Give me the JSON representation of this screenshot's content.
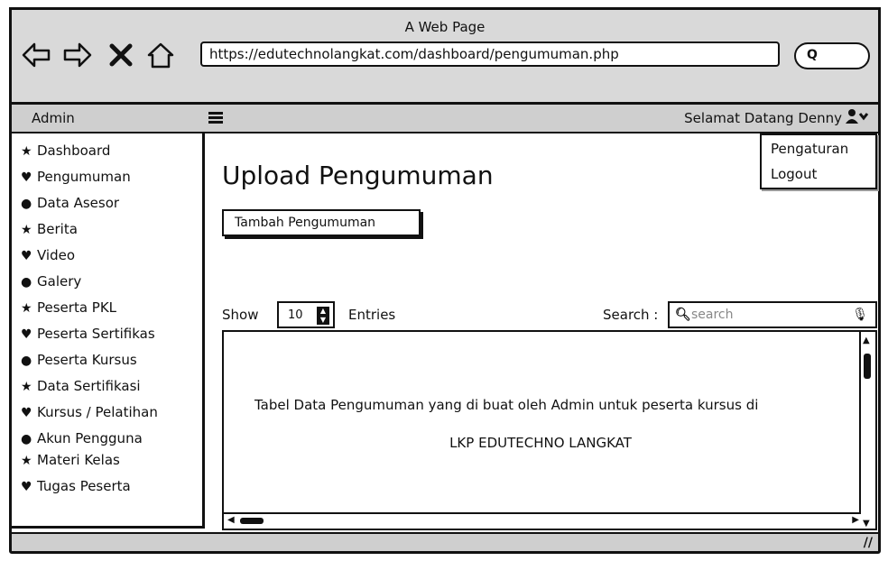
{
  "window": {
    "title": "A Web Page"
  },
  "browser": {
    "url": "https://edutechnolangkat.com/dashboard/pengumuman.php",
    "nav_icons": [
      "back-arrow-icon",
      "forward-arrow-icon",
      "close-x-icon",
      "home-icon"
    ],
    "search_icon": "Q"
  },
  "menubar": {
    "brand": "Admin",
    "greeting": "Selamat Datang Denny",
    "user_icon": "user-icon"
  },
  "user_menu": {
    "items": [
      "Pengaturan",
      "Logout"
    ]
  },
  "sidebar": {
    "items": [
      {
        "label": "Dashboard",
        "icon": "star"
      },
      {
        "label": "Pengumuman",
        "icon": "heart"
      },
      {
        "label": "Data Asesor",
        "icon": "circle"
      },
      {
        "label": "Berita",
        "icon": "star"
      },
      {
        "label": "Video",
        "icon": "heart"
      },
      {
        "label": "Galery",
        "icon": "circle"
      },
      {
        "label": "Peserta PKL",
        "icon": "star"
      },
      {
        "label": "Peserta Sertifikas",
        "icon": "heart"
      },
      {
        "label": "Peserta Kursus",
        "icon": "circle"
      },
      {
        "label": "Data Sertifikasi",
        "icon": "star"
      },
      {
        "label": "Kursus / Pelatihan",
        "icon": "heart"
      },
      {
        "label": "Akun Pengguna",
        "icon": "circle"
      },
      {
        "label": "Materi Kelas",
        "icon": "star"
      },
      {
        "label": "Tugas Peserta",
        "icon": "heart"
      }
    ]
  },
  "main": {
    "title": "Upload Pengumuman",
    "add_button": "Tambah Pengumuman",
    "show_label": "Show",
    "entries_value": "10",
    "entries_label": "Entries",
    "search_label": "Search :",
    "search_placeholder": "search",
    "table_text_line1": "Tabel Data Pengumuman yang di buat oleh Admin untuk peserta kursus di",
    "table_text_line2": "LKP EDUTECHNO LANGKAT"
  }
}
